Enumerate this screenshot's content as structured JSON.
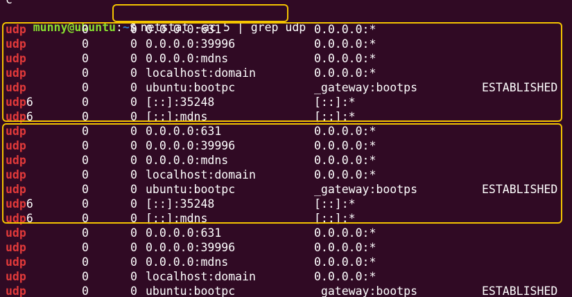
{
  "terminal": {
    "top_fragment": "c",
    "prompt": {
      "user_host": "munny@ubuntu",
      "colon": ":",
      "path": "~",
      "dollar": "$"
    },
    "command": "netstat -ac 5 | grep udp",
    "grep_match": "udp",
    "colors": {
      "background": "#300a24",
      "prompt_user": "#87df2f",
      "prompt_path": "#2f7fd1",
      "grep_match": "#e23a3a",
      "highlight_box": "#f4c400",
      "text": "#ffffff"
    },
    "rows": [
      {
        "proto_suffix": "",
        "recv": "0",
        "send": "0",
        "local": "0.0.0.0:631",
        "foreign": "0.0.0.0:*",
        "state": ""
      },
      {
        "proto_suffix": "",
        "recv": "0",
        "send": "0",
        "local": "0.0.0.0:39996",
        "foreign": "0.0.0.0:*",
        "state": ""
      },
      {
        "proto_suffix": "",
        "recv": "0",
        "send": "0",
        "local": "0.0.0.0:mdns",
        "foreign": "0.0.0.0:*",
        "state": ""
      },
      {
        "proto_suffix": "",
        "recv": "0",
        "send": "0",
        "local": "localhost:domain",
        "foreign": "0.0.0.0:*",
        "state": ""
      },
      {
        "proto_suffix": "",
        "recv": "0",
        "send": "0",
        "local": "ubuntu:bootpc",
        "foreign": "_gateway:bootps",
        "state": "ESTABLISHED"
      },
      {
        "proto_suffix": "6",
        "recv": "0",
        "send": "0",
        "local": "[::]:35248",
        "foreign": "[::]:*",
        "state": ""
      },
      {
        "proto_suffix": "6",
        "recv": "0",
        "send": "0",
        "local": "[::]:mdns",
        "foreign": "[::]:*",
        "state": ""
      },
      {
        "proto_suffix": "",
        "recv": "0",
        "send": "0",
        "local": "0.0.0.0:631",
        "foreign": "0.0.0.0:*",
        "state": ""
      },
      {
        "proto_suffix": "",
        "recv": "0",
        "send": "0",
        "local": "0.0.0.0:39996",
        "foreign": "0.0.0.0:*",
        "state": ""
      },
      {
        "proto_suffix": "",
        "recv": "0",
        "send": "0",
        "local": "0.0.0.0:mdns",
        "foreign": "0.0.0.0:*",
        "state": ""
      },
      {
        "proto_suffix": "",
        "recv": "0",
        "send": "0",
        "local": "localhost:domain",
        "foreign": "0.0.0.0:*",
        "state": ""
      },
      {
        "proto_suffix": "",
        "recv": "0",
        "send": "0",
        "local": "ubuntu:bootpc",
        "foreign": "_gateway:bootps",
        "state": "ESTABLISHED"
      },
      {
        "proto_suffix": "6",
        "recv": "0",
        "send": "0",
        "local": "[::]:35248",
        "foreign": "[::]:*",
        "state": ""
      },
      {
        "proto_suffix": "6",
        "recv": "0",
        "send": "0",
        "local": "[::]:mdns",
        "foreign": "[::]:*",
        "state": ""
      },
      {
        "proto_suffix": "",
        "recv": "0",
        "send": "0",
        "local": "0.0.0.0:631",
        "foreign": "0.0.0.0:*",
        "state": ""
      },
      {
        "proto_suffix": "",
        "recv": "0",
        "send": "0",
        "local": "0.0.0.0:39996",
        "foreign": "0.0.0.0:*",
        "state": ""
      },
      {
        "proto_suffix": "",
        "recv": "0",
        "send": "0",
        "local": "0.0.0.0:mdns",
        "foreign": "0.0.0.0:*",
        "state": ""
      },
      {
        "proto_suffix": "",
        "recv": "0",
        "send": "0",
        "local": "localhost:domain",
        "foreign": "0.0.0.0:*",
        "state": ""
      },
      {
        "proto_suffix": "",
        "recv": "0",
        "send": "0",
        "local": "ubuntu:bootpc",
        "foreign": "_gateway:bootps",
        "state": "ESTABLISHED"
      }
    ]
  }
}
